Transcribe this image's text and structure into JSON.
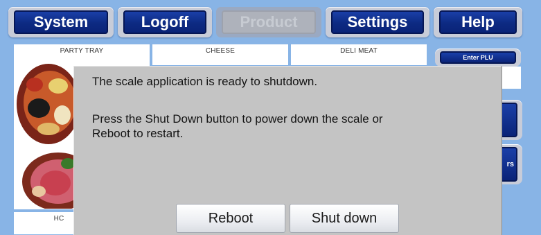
{
  "nav": {
    "items": [
      {
        "label": "System",
        "enabled": true
      },
      {
        "label": "Logoff",
        "enabled": true
      },
      {
        "label": "Product",
        "enabled": false
      },
      {
        "label": "Settings",
        "enabled": true
      },
      {
        "label": "Help",
        "enabled": true
      }
    ]
  },
  "products": {
    "tiles": [
      {
        "label": "PARTY TRAY"
      },
      {
        "label": "CHEESE"
      },
      {
        "label": "DELI MEAT"
      },
      {
        "label": "HC"
      }
    ]
  },
  "side": {
    "enter_plu_label": "Enter PLU",
    "partial_label": "rs"
  },
  "dialog": {
    "message_line1": "The scale application is ready to shutdown.",
    "message_line2": "Press the Shut Down button to power down the scale or",
    "message_line3": "Reboot to restart.",
    "reboot_label": "Reboot",
    "shutdown_label": "Shut down"
  },
  "colors": {
    "background": "#88b4e6",
    "nav_button": "#0d2a82",
    "dialog": "#c4c4c4"
  }
}
